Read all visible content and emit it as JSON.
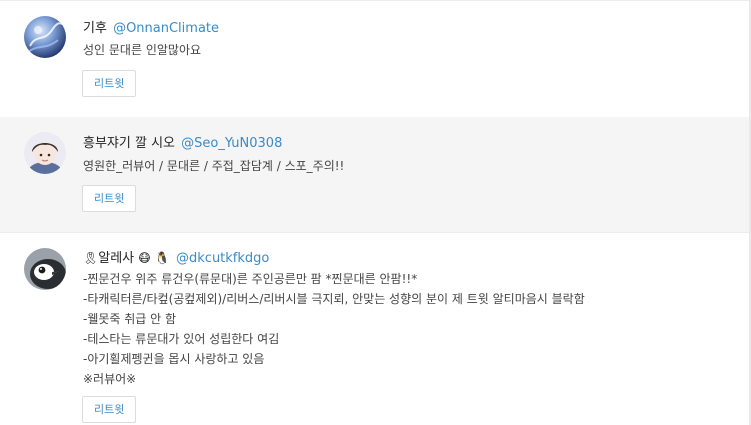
{
  "accounts": [
    {
      "name": "기후",
      "handle": "@OnnanClimate",
      "bio_lines": [
        "성인 문대른 인알많아요"
      ],
      "button_label": "리트윗"
    },
    {
      "name": "흥부쟈기 깔 시오",
      "handle": "@Seo_YuN0308",
      "bio_lines": [
        "영원한_러뷰어 / 문대른 / 주접_잡담계 / 스포_주의!!"
      ],
      "button_label": "리트윗"
    },
    {
      "name_ribbon": "🎗",
      "name": "알레사",
      "name_emoji_1": "😷",
      "name_emoji_2": "🐧",
      "handle": "@dkcutkfkdgo",
      "bio_lines": [
        "-찐문건우 위주 류건우(류문대)른 주인공른만 팜 *찐문대른 안팜!!*",
        "-타캐릭터른/타컾(공컾제외)/리버스/리버시블 극지뢰, 안맞는 성향의 분이 제 트윗 알티마음시 블락함",
        "-웰못죽 취급 안 함",
        "-테스타는 류문대가 있어 성립한다 여김",
        "-아기횔제펭귄을 몹시 사랑하고 있음",
        "※러뷰어※"
      ],
      "button_label": "리트윗"
    }
  ]
}
